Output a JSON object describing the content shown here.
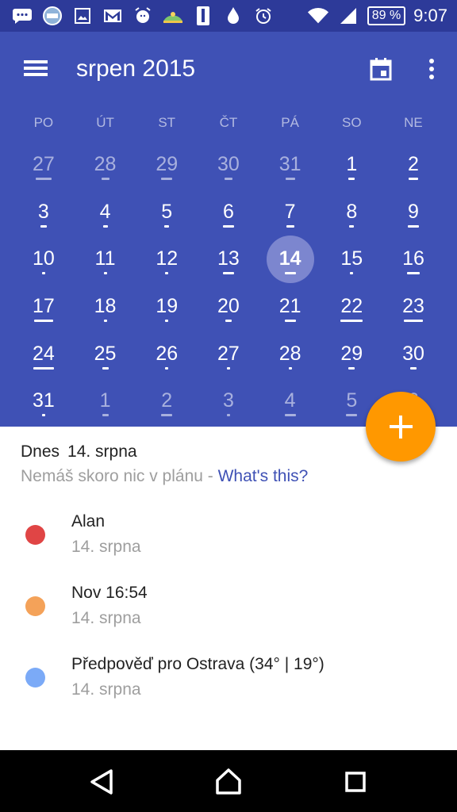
{
  "status_bar": {
    "battery": "89 %",
    "time": "9:07"
  },
  "app_bar": {
    "title": "srpen 2015"
  },
  "weekdays": [
    "PO",
    "ÚT",
    "ST",
    "ČT",
    "PÁ",
    "SO",
    "NE"
  ],
  "days": [
    "27",
    "28",
    "29",
    "30",
    "31",
    "1",
    "2",
    "3",
    "4",
    "5",
    "6",
    "7",
    "8",
    "9",
    "10",
    "11",
    "12",
    "13",
    "14",
    "15",
    "16",
    "17",
    "18",
    "19",
    "20",
    "21",
    "22",
    "23",
    "24",
    "25",
    "26",
    "27",
    "28",
    "29",
    "30",
    "31",
    "1",
    "2",
    "3",
    "4",
    "5",
    "6"
  ],
  "today_section": {
    "label": "Dnes",
    "date": "14. srpna",
    "subtitle": "Nemáš skoro nic v plánu - ",
    "link": "What's this?"
  },
  "events": [
    {
      "title": "Alan",
      "date": "14. srpna",
      "color": "#e04545"
    },
    {
      "title": "Nov 16:54",
      "date": "14. srpna",
      "color": "#f4a259"
    },
    {
      "title": "Předpověď pro Ostrava (34° | 19°)",
      "date": "14. srpna",
      "color": "#7baaf7"
    }
  ],
  "colors": {
    "primary": "#3f51b5",
    "status_bar": "#2d3a99",
    "fab": "#ff9800"
  }
}
